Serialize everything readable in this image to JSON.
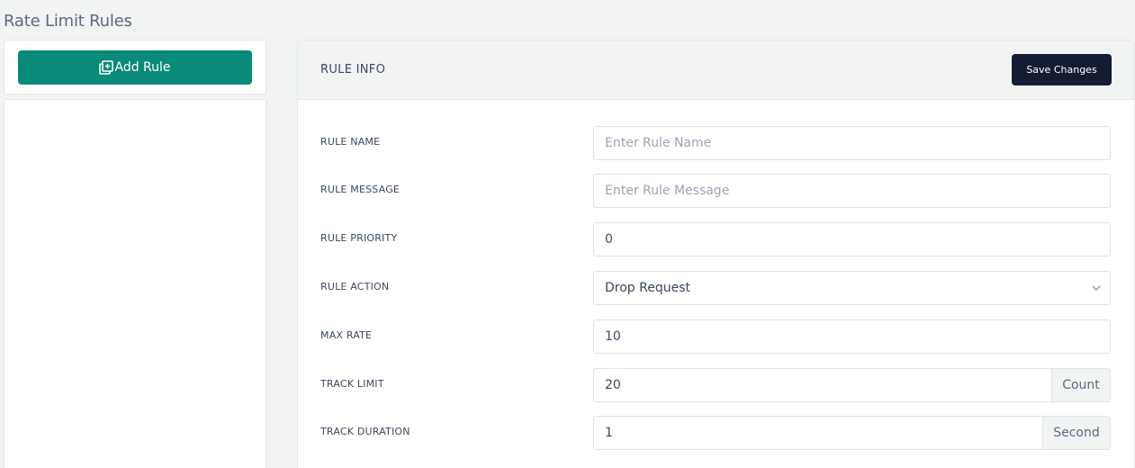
{
  "page": {
    "title": "Rate Limit Rules"
  },
  "sidebar": {
    "add_rule_label": "Add Rule"
  },
  "panel": {
    "title": "RULE INFO",
    "save_label": "Save Changes"
  },
  "form": {
    "rule_name": {
      "label": "RULE NAME",
      "placeholder": "Enter Rule Name",
      "value": ""
    },
    "rule_message": {
      "label": "RULE MESSAGE",
      "placeholder": "Enter Rule Message",
      "value": ""
    },
    "rule_priority": {
      "label": "RULE PRIORITY",
      "value": "0"
    },
    "rule_action": {
      "label": "RULE ACTION",
      "value": "Drop Request"
    },
    "max_rate": {
      "label": "MAX RATE",
      "value": "10"
    },
    "track_limit": {
      "label": "TRACK LIMIT",
      "value": "20",
      "unit": "Count"
    },
    "track_duration": {
      "label": "TRACK DURATION",
      "value": "1",
      "unit": "Second"
    }
  },
  "colors": {
    "accent": "#0a8a78",
    "primary_dark": "#141c33",
    "background": "#f2f3f3"
  }
}
